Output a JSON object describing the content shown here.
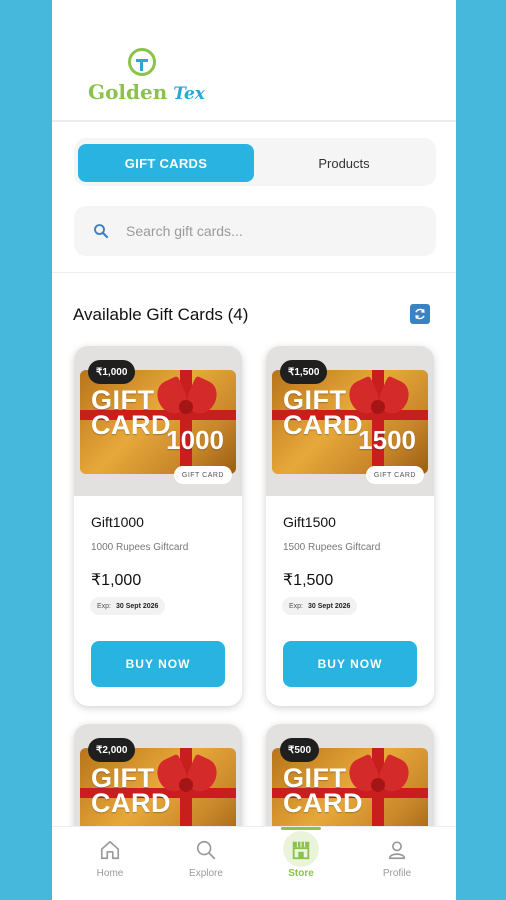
{
  "logo": {
    "word1": "Golden",
    "word2": "Tex"
  },
  "tabs": [
    {
      "label": "GIFT CARDS",
      "active": true
    },
    {
      "label": "Products",
      "active": false
    }
  ],
  "search": {
    "placeholder": "Search gift cards...",
    "value": ""
  },
  "section": {
    "title": "Available Gift Cards (4)"
  },
  "cards": [
    {
      "badge": "₹1,000",
      "image_word1": "GIFT",
      "image_word2": "CARD",
      "image_amount": "1000",
      "image_chip": "GIFT CARD",
      "name": "Gift1000",
      "description": "1000 Rupees Giftcard",
      "price": "₹1,000",
      "expiry_label": "Exp:",
      "expiry_date": "30 Sept 2026",
      "button": "BUY NOW"
    },
    {
      "badge": "₹1,500",
      "image_word1": "GIFT",
      "image_word2": "CARD",
      "image_amount": "1500",
      "image_chip": "GIFT CARD",
      "name": "Gift1500",
      "description": "1500 Rupees Giftcard",
      "price": "₹1,500",
      "expiry_label": "Exp:",
      "expiry_date": "30 Sept 2026",
      "button": "BUY NOW"
    },
    {
      "badge": "₹2,000",
      "image_word1": "GIFT",
      "image_word2": "CARD"
    },
    {
      "badge": "₹500",
      "image_word1": "GIFT",
      "image_word2": "CARD"
    }
  ],
  "nav": [
    {
      "label": "Home",
      "icon": "home-icon",
      "active": false
    },
    {
      "label": "Explore",
      "icon": "search-icon",
      "active": false
    },
    {
      "label": "Store",
      "icon": "store-icon",
      "active": true
    },
    {
      "label": "Profile",
      "icon": "user-icon",
      "active": false
    }
  ],
  "colors": {
    "accent": "#29b3e0",
    "brand_green": "#8bc34a",
    "background": "#45b8dc"
  }
}
